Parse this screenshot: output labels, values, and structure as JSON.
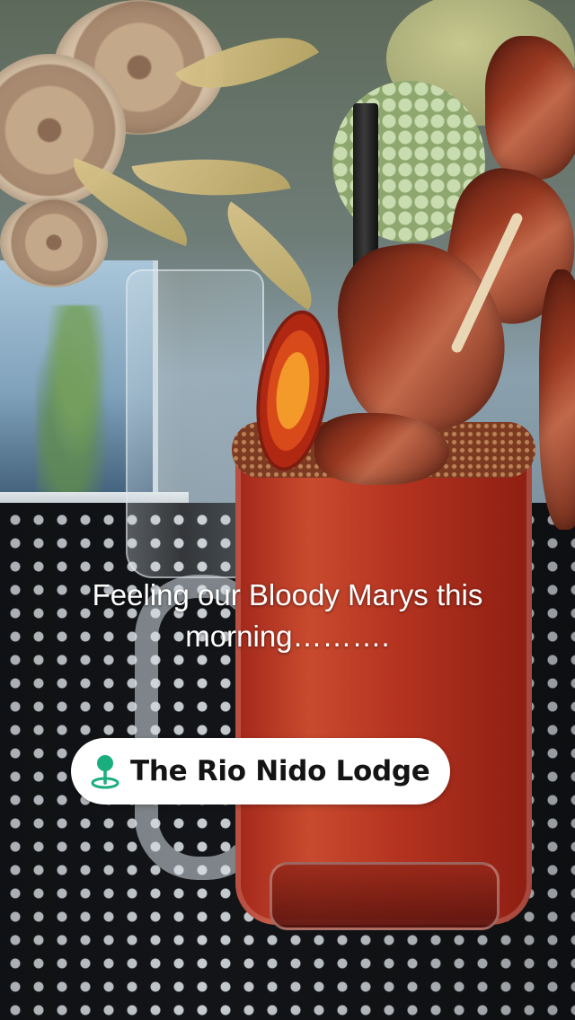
{
  "post": {
    "caption_lines": [
      "Feeling our Bloody Marys this",
      "morning………."
    ]
  },
  "location_tag": {
    "name": "The Rio Nido Lodge",
    "icon": "map-pin-icon",
    "accent_color": "#1aae7e"
  },
  "media": {
    "subject": "bloody-mary-photo"
  }
}
